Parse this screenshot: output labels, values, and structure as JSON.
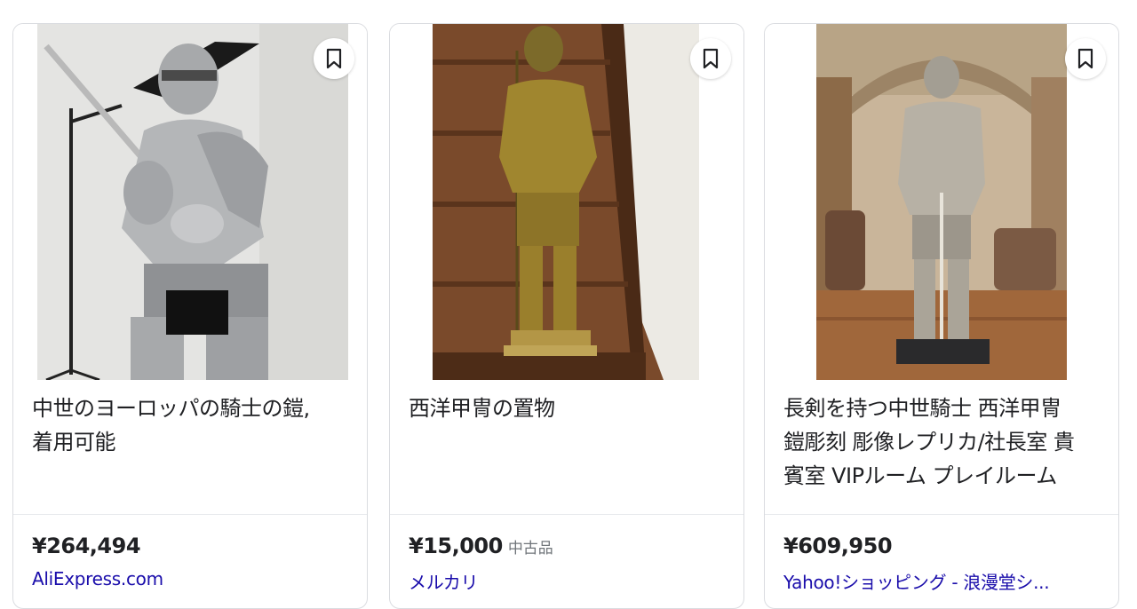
{
  "results": [
    {
      "title_line1": "中世のヨーロッパの騎士の鎧,",
      "title_line2": "着用可能",
      "title_line3": "",
      "price": "¥264,494",
      "condition": "",
      "merchant": "AliExpress.com",
      "image_icon": "armor-knight-photo"
    },
    {
      "title_line1": "西洋甲冑の置物",
      "title_line2": "",
      "title_line3": "",
      "price": "¥15,000",
      "condition": "中古品",
      "merchant": "メルカリ",
      "image_icon": "armor-figurine-photo"
    },
    {
      "title_line1": "長剣を持つ中世騎士 西洋甲冑",
      "title_line2": "鎧彫刻 彫像レプリカ/社長室 貴",
      "title_line3": "賓室 VIPルーム プレイルーム",
      "price": "¥609,950",
      "condition": "",
      "merchant": "Yahoo!ショッピング - 浪漫堂シ...",
      "image_icon": "armor-statue-hall-photo"
    }
  ],
  "save_icon": "bookmark-icon",
  "colors": {
    "merchant_link": "#1a0dab",
    "price_text": "#202124",
    "condition_text": "#70757a",
    "card_border": "#dadce0"
  }
}
